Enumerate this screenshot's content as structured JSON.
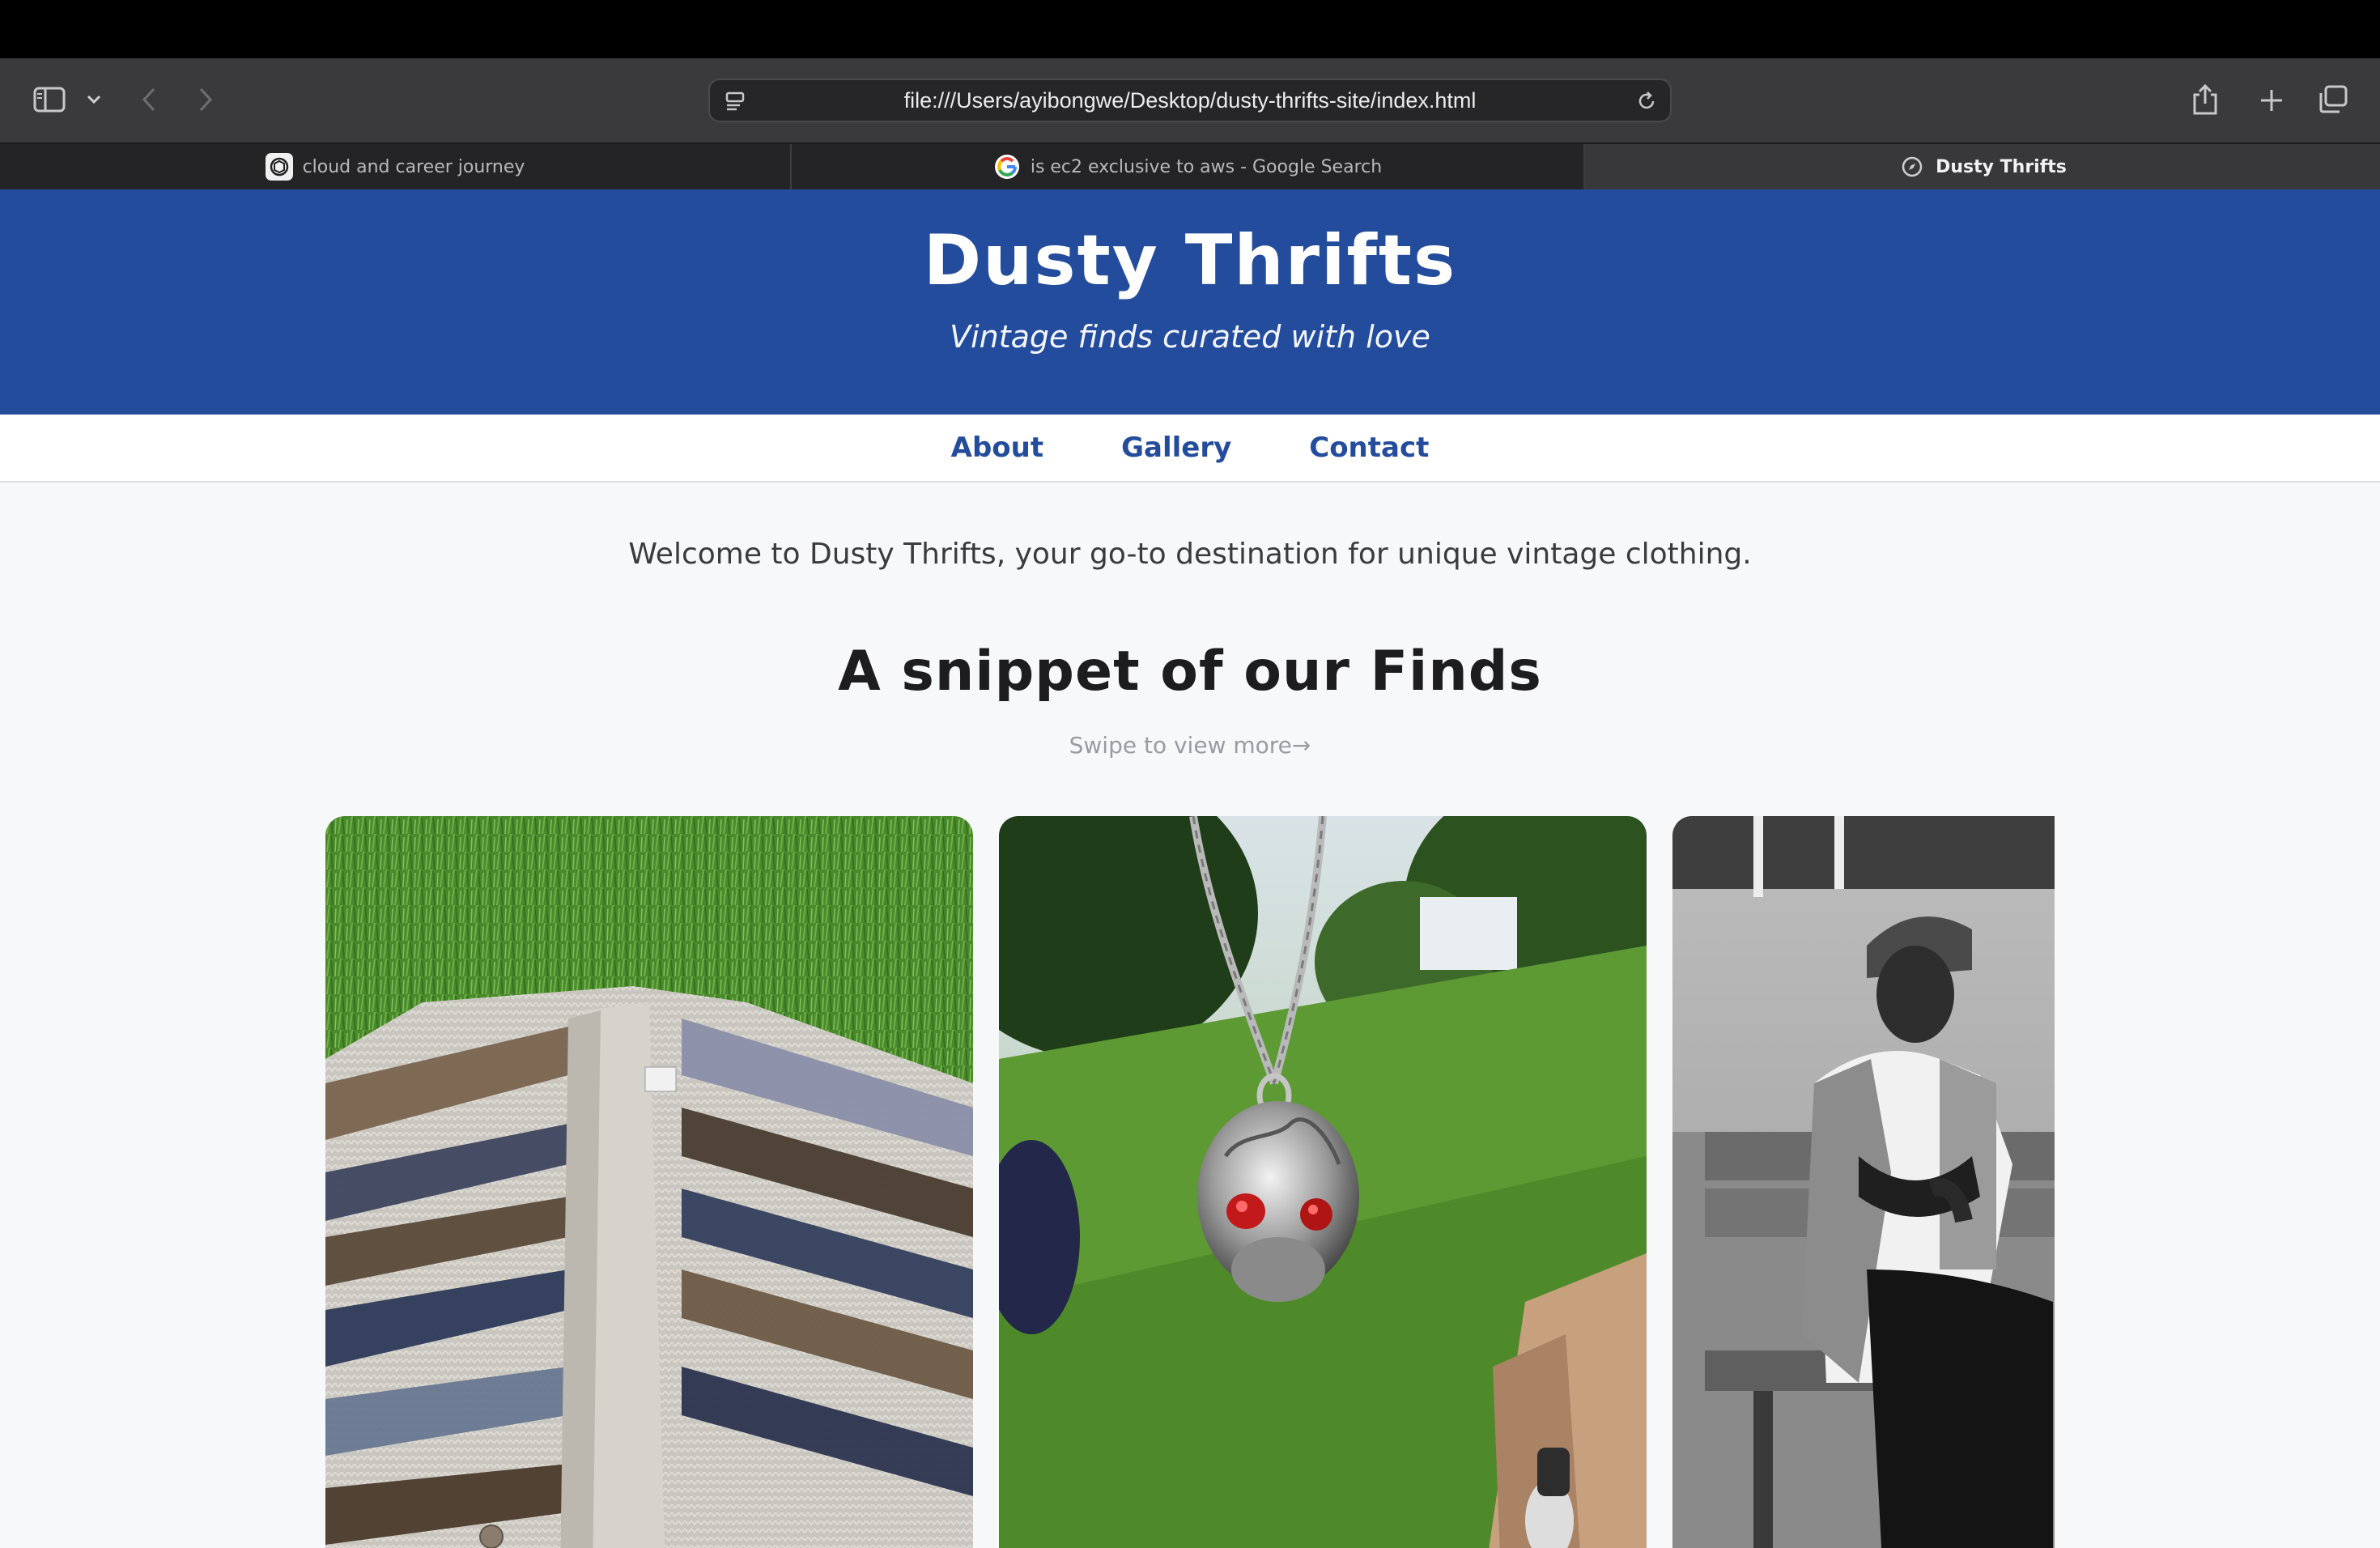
{
  "browser": {
    "url": "file:///Users/ayibongwe/Desktop/dusty-thrifts-site/index.html",
    "tabs": [
      {
        "label": "cloud and career journey",
        "icon": "chatgpt-icon",
        "active": false
      },
      {
        "label": "is ec2 exclusive to aws - Google Search",
        "icon": "google-icon",
        "active": false
      },
      {
        "label": "Dusty Thrifts",
        "icon": "compass-icon",
        "active": true
      }
    ]
  },
  "site": {
    "title": "Dusty Thrifts",
    "tagline": "Vintage finds curated with love",
    "nav": [
      "About",
      "Gallery",
      "Contact"
    ],
    "welcome": "Welcome to Dusty Thrifts, your go-to destination for unique vintage clothing.",
    "section_title": "A snippet of our Finds",
    "swipe_hint": "Swipe to view more→"
  },
  "gallery": {
    "items": [
      {
        "image": "knit-cardigan-on-grass"
      },
      {
        "image": "skull-pendant-necklace"
      },
      {
        "image": "man-on-bench-black-and-white"
      }
    ]
  },
  "colors": {
    "header_blue": "#244c9c",
    "nav_link": "#244c9c",
    "page_bg": "#f7f8fa"
  }
}
